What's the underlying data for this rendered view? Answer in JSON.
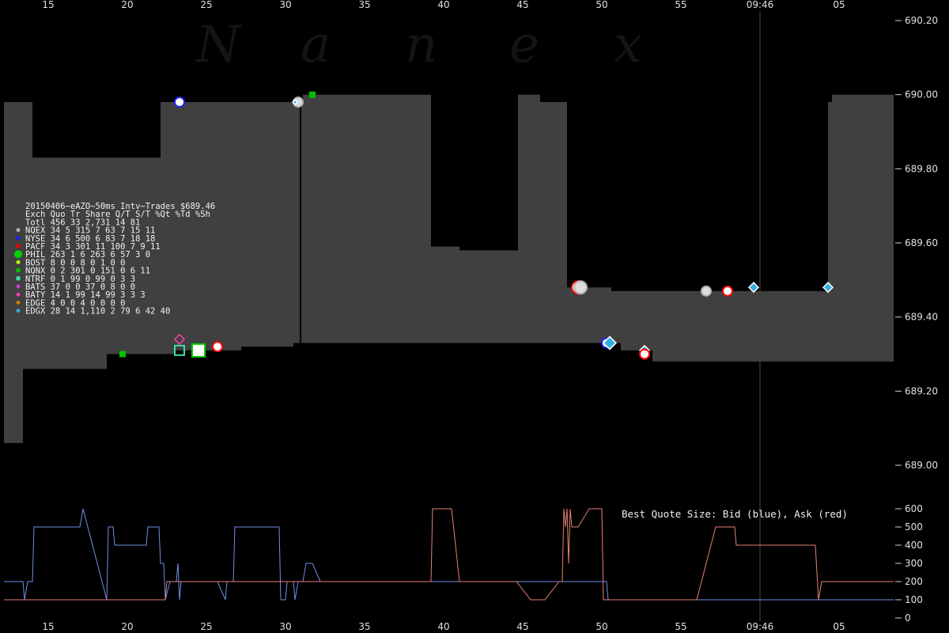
{
  "watermark": "N a n e x",
  "chart_data": [
    {
      "type": "area",
      "title": "20150406~eAZO~50ms Intv~Trades $689.46",
      "time_ticks": [
        "15",
        "20",
        "25",
        "30",
        "35",
        "40",
        "45",
        "50",
        "55",
        "09:46",
        "05"
      ],
      "ylim": [
        688.9,
        690.25
      ],
      "yticks": [
        "690.20",
        "690.00",
        "689.80",
        "689.60",
        "689.40",
        "689.20",
        "689.00"
      ],
      "ask": [
        {
          "t": 0.0,
          "p": 689.98
        },
        {
          "t": 3.6,
          "p": 689.83
        },
        {
          "t": 19.8,
          "p": 689.98
        },
        {
          "t": 37.8,
          "p": 690.0
        },
        {
          "t": 54.0,
          "p": 689.59
        },
        {
          "t": 57.6,
          "p": 689.58
        },
        {
          "t": 65.0,
          "p": 690.0
        },
        {
          "t": 67.8,
          "p": 689.98
        },
        {
          "t": 71.2,
          "p": 689.48
        },
        {
          "t": 76.8,
          "p": 689.47
        },
        {
          "t": 104.2,
          "p": 689.98
        },
        {
          "t": 104.7,
          "p": 690.0
        },
        {
          "t": 112.5,
          "p": 690.0
        }
      ],
      "bid": [
        {
          "t": 0.0,
          "p": 689.06
        },
        {
          "t": 2.4,
          "p": 689.26
        },
        {
          "t": 13.0,
          "p": 689.3
        },
        {
          "t": 21.6,
          "p": 689.31
        },
        {
          "t": 30.0,
          "p": 689.32
        },
        {
          "t": 36.6,
          "p": 689.33
        },
        {
          "t": 37.8,
          "p": 689.33
        },
        {
          "t": 78.0,
          "p": 689.31
        },
        {
          "t": 82.0,
          "p": 689.28
        },
        {
          "t": 112.5,
          "p": 689.28
        }
      ],
      "trades": [
        {
          "t": 22.2,
          "p": 689.98,
          "exch": "NYSE",
          "size": "m"
        },
        {
          "t": 37.2,
          "p": 689.98,
          "exch": "NQEX",
          "size": "m"
        },
        {
          "t": 39.0,
          "p": 690.0,
          "exch": "NQNX",
          "size": "s"
        },
        {
          "t": 36.8,
          "p": 689.98,
          "exch": "EDGX",
          "size": "s"
        },
        {
          "t": 15.0,
          "p": 689.3,
          "exch": "NQNX",
          "size": "s"
        },
        {
          "t": 22.2,
          "p": 689.34,
          "exch": "BATY",
          "size": "m"
        },
        {
          "t": 22.2,
          "p": 689.31,
          "exch": "NTRF",
          "size": "m"
        },
        {
          "t": 24.6,
          "p": 689.31,
          "exch": "PHIL",
          "size": "l"
        },
        {
          "t": 27.0,
          "p": 689.32,
          "exch": "PACF",
          "size": "m"
        },
        {
          "t": 72.6,
          "p": 689.48,
          "exch": "PACF",
          "size": "l"
        },
        {
          "t": 72.9,
          "p": 689.48,
          "exch": "NQEX",
          "size": "l"
        },
        {
          "t": 76.2,
          "p": 689.33,
          "exch": "NYSE",
          "size": "m"
        },
        {
          "t": 76.6,
          "p": 689.33,
          "exch": "EDGX",
          "size": "l"
        },
        {
          "t": 81.0,
          "p": 689.31,
          "exch": "EDGX",
          "size": "m"
        },
        {
          "t": 81.0,
          "p": 689.3,
          "exch": "PACF",
          "size": "m"
        },
        {
          "t": 88.8,
          "p": 689.47,
          "exch": "NQEX",
          "size": "m"
        },
        {
          "t": 91.5,
          "p": 689.47,
          "exch": "PACF",
          "size": "m"
        },
        {
          "t": 94.8,
          "p": 689.48,
          "exch": "EDGX",
          "size": "m"
        },
        {
          "t": 104.2,
          "p": 689.48,
          "exch": "EDGX",
          "size": "m"
        }
      ],
      "exchange_colors": {
        "NQEX": "#b0b0b0",
        "NYSE": "#2020ff",
        "PACF": "#ff0000",
        "PHIL": "#00d000",
        "BOST": "#b0ff00",
        "NQNX": "#00c000",
        "NTRF": "#40e0a0",
        "BATS": "#d040d0",
        "BATY": "#ff40b0",
        "EDGE": "#d08000",
        "EDGX": "#30b0e0"
      },
      "fill_color": "#404040",
      "table": {
        "header": "Exch Quo Tr Share  Q/T   S/T  %Qt %Td %Sh",
        "total": "Totl 456 33 2,731   14    81",
        "rows": [
          {
            "text": "NQEX  34  5   315    7    63   7  15  11",
            "exch": "NQEX"
          },
          {
            "text": "NYSE  34  6   500    6    83   7  18  18",
            "exch": "NYSE"
          },
          {
            "text": "PACF  34  3   301   11   100   7   9  11",
            "exch": "PACF"
          },
          {
            "text": "PHIL 263  1     6  263     6  57   3   0",
            "exch": "PHIL"
          },
          {
            "text": "BOST   8  0     0    8     0   1   0   0",
            "exch": "BOST"
          },
          {
            "text": "NQNX   0  2   301    0   151   0   6  11",
            "exch": "NQNX"
          },
          {
            "text": "NTRF   0  1    99    0    99   0   3   3",
            "exch": "NTRF"
          },
          {
            "text": "BATS  37  0     0   37     0   8   0   0",
            "exch": "BATS"
          },
          {
            "text": "BATY  14  1    99   14    99   3   3   3",
            "exch": "BATY"
          },
          {
            "text": "EDGE   4  0     0    4     0   0   0   0",
            "exch": "EDGE"
          },
          {
            "text": "EDGX  28 14 1,110    2    79   6  42  40",
            "exch": "EDGX"
          }
        ]
      }
    },
    {
      "type": "line",
      "title": "Best Quote Size: Bid (blue), Ask (red)",
      "ylim": [
        0,
        600
      ],
      "yticks": [
        "600",
        "500",
        "400",
        "300",
        "200",
        "100",
        "0"
      ],
      "series": [
        {
          "name": "Bid",
          "color": "#7090e8",
          "values": [
            [
              0,
              200
            ],
            [
              2.4,
              200
            ],
            [
              2.6,
              100
            ],
            [
              3.0,
              200
            ],
            [
              3.6,
              200
            ],
            [
              3.8,
              500
            ],
            [
              9.6,
              500
            ],
            [
              10.0,
              600
            ],
            [
              13.0,
              100
            ],
            [
              13.2,
              500
            ],
            [
              13.8,
              500
            ],
            [
              14.0,
              400
            ],
            [
              18.0,
              400
            ],
            [
              18.2,
              500
            ],
            [
              19.6,
              500
            ],
            [
              19.8,
              300
            ],
            [
              20.2,
              300
            ],
            [
              20.4,
              100
            ],
            [
              21.0,
              200
            ],
            [
              21.8,
              200
            ],
            [
              22.0,
              300
            ],
            [
              22.2,
              100
            ],
            [
              22.4,
              200
            ],
            [
              27.0,
              200
            ],
            [
              28.0,
              100
            ],
            [
              28.2,
              200
            ],
            [
              29.0,
              200
            ],
            [
              29.2,
              500
            ],
            [
              34.8,
              500
            ],
            [
              35.0,
              100
            ],
            [
              35.6,
              100
            ],
            [
              35.8,
              200
            ],
            [
              36.6,
              200
            ],
            [
              36.8,
              100
            ],
            [
              37.2,
              200
            ],
            [
              37.8,
              200
            ],
            [
              38.2,
              300
            ],
            [
              39.0,
              300
            ],
            [
              40.0,
              200
            ],
            [
              75.6,
              200
            ],
            [
              76.2,
              200
            ],
            [
              76.4,
              100
            ],
            [
              112.5,
              100
            ]
          ]
        },
        {
          "name": "Ask",
          "color": "#e88070",
          "values": [
            [
              0,
              100
            ],
            [
              20.4,
              100
            ],
            [
              20.6,
              200
            ],
            [
              54.0,
              200
            ],
            [
              54.2,
              600
            ],
            [
              56.6,
              600
            ],
            [
              57.6,
              200
            ],
            [
              64.8,
              200
            ],
            [
              66.6,
              100
            ],
            [
              68.4,
              100
            ],
            [
              70.2,
              200
            ],
            [
              70.6,
              200
            ],
            [
              70.8,
              600
            ],
            [
              71.0,
              500
            ],
            [
              71.2,
              600
            ],
            [
              71.4,
              300
            ],
            [
              71.6,
              600
            ],
            [
              71.8,
              500
            ],
            [
              72.6,
              500
            ],
            [
              74.0,
              600
            ],
            [
              75.6,
              600
            ],
            [
              75.8,
              100
            ],
            [
              87.6,
              100
            ],
            [
              90.0,
              500
            ],
            [
              92.4,
              500
            ],
            [
              92.6,
              400
            ],
            [
              102.6,
              400
            ],
            [
              103.0,
              100
            ],
            [
              103.4,
              200
            ],
            [
              112.5,
              200
            ]
          ]
        }
      ]
    }
  ]
}
